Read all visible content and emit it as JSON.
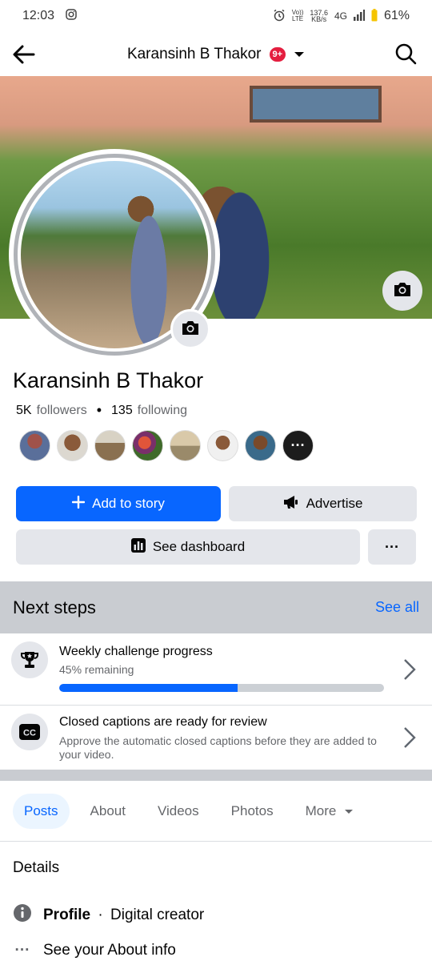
{
  "status_bar": {
    "time": "12:03",
    "net_top": "137.6",
    "net_bottom": "KB/s",
    "net_type": "4G",
    "volte_top": "Vo))",
    "volte_bottom": "LTE",
    "battery": "61%"
  },
  "header": {
    "title": "Karansinh B Thakor",
    "badge": "9+"
  },
  "profile": {
    "name": "Karansinh B Thakor",
    "followers_count": "5K",
    "followers_label": "followers",
    "following_count": "135",
    "following_label": "following",
    "friend_more": "···"
  },
  "actions": {
    "add_story": "Add to story",
    "advertise": "Advertise",
    "dashboard": "See dashboard",
    "more": "···"
  },
  "next_steps": {
    "title": "Next steps",
    "see_all": "See all",
    "items": [
      {
        "title": "Weekly challenge progress",
        "subtitle": "45% remaining",
        "progress": 0.55
      },
      {
        "title": "Closed captions are ready for review",
        "subtitle": "Approve the automatic closed captions before they are added to your video."
      }
    ]
  },
  "tabs": [
    "Posts",
    "About",
    "Videos",
    "Photos",
    "More"
  ],
  "details": {
    "title": "Details",
    "profile_label": "Profile",
    "profile_sep": "·",
    "profile_value": "Digital creator",
    "about_link": "See your About info"
  },
  "colors": {
    "accent": "#0866ff",
    "badge": "#e41e3f",
    "gray_button": "#e4e6eb",
    "section_bg": "#c9ccd1"
  }
}
